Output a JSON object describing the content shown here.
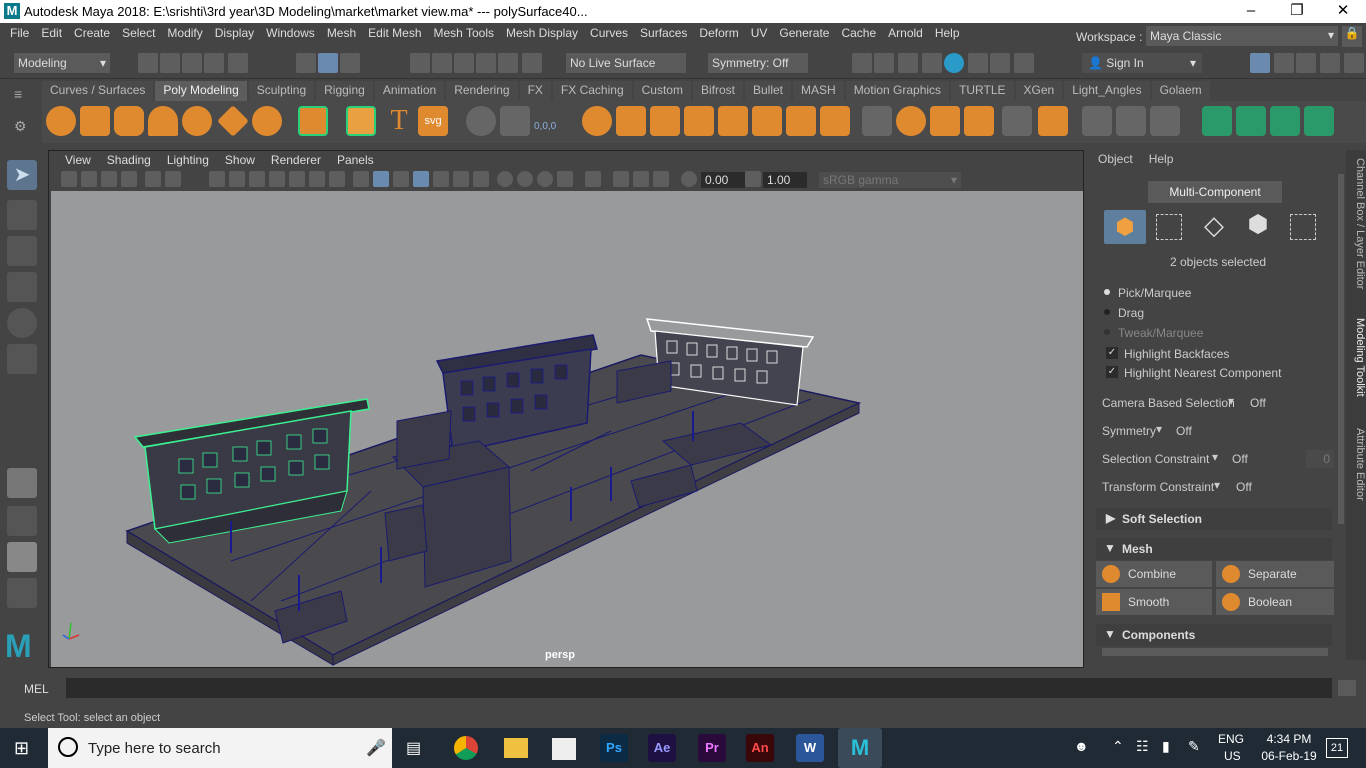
{
  "window": {
    "title": "Autodesk Maya 2018: E:\\srishti\\3rd year\\3D Modeling\\market\\market view.ma*   ---   polySurface40...",
    "logo_letter": "M"
  },
  "menubar": {
    "items": [
      "File",
      "Edit",
      "Create",
      "Select",
      "Modify",
      "Display",
      "Windows",
      "Mesh",
      "Edit Mesh",
      "Mesh Tools",
      "Mesh Display",
      "Curves",
      "Surfaces",
      "Deform",
      "UV",
      "Generate",
      "Cache",
      "Arnold",
      "Help"
    ]
  },
  "workspace": {
    "label": "Workspace :",
    "value": "Maya Classic"
  },
  "statusline": {
    "menu_set": "Modeling",
    "live_surface": "No Live Surface",
    "symmetry": "Symmetry: Off",
    "sign_in": "Sign In"
  },
  "shelf": {
    "tabs": [
      "Curves / Surfaces",
      "Poly Modeling",
      "Sculpting",
      "Rigging",
      "Animation",
      "Rendering",
      "FX",
      "FX Caching",
      "Custom",
      "Bifrost",
      "Bullet",
      "MASH",
      "Motion Graphics",
      "TURTLE",
      "XGen",
      "Light_Angles",
      "Golaem"
    ],
    "active_tab": "Poly Modeling",
    "text_icon_T": "T",
    "text_icon_svg": "svg",
    "coord_label": "0,0,0"
  },
  "viewport": {
    "menus": [
      "View",
      "Shading",
      "Lighting",
      "Show",
      "Renderer",
      "Panels"
    ],
    "exposure": "0.00",
    "gamma": "1.00",
    "color_space": "sRGB gamma",
    "camera_label": "persp"
  },
  "modeling_toolkit": {
    "menus": [
      "Object",
      "Help"
    ],
    "mode_button": "Multi-Component",
    "selection_status": "2 objects selected",
    "pick_options": [
      "Pick/Marquee",
      "Drag",
      "Tweak/Marquee"
    ],
    "checkboxes": [
      "Highlight Backfaces",
      "Highlight Nearest Component"
    ],
    "camera_based_selection": {
      "label": "Camera Based Selection",
      "value": "Off"
    },
    "symmetry": {
      "label": "Symmetry",
      "value": "Off"
    },
    "selection_constraint": {
      "label": "Selection Constraint",
      "value": "Off",
      "extra": "0"
    },
    "transform_constraint": {
      "label": "Transform Constraint",
      "value": "Off"
    },
    "sections": {
      "soft_selection": "Soft Selection",
      "mesh": "Mesh",
      "components": "Components"
    },
    "mesh_buttons": [
      "Combine",
      "Separate",
      "Smooth",
      "Boolean"
    ]
  },
  "side_tabs": [
    "Channel Box / Layer Editor",
    "Modeling Toolkit",
    "Attribute Editor"
  ],
  "cmdline": {
    "label": "MEL"
  },
  "helpline": {
    "text": "Select Tool: select an object"
  },
  "taskbar": {
    "search_placeholder": "Type here to search",
    "apps": [
      "Ps",
      "Ae",
      "Pr",
      "An",
      "W",
      "M"
    ],
    "language": "ENG",
    "region": "US",
    "time": "4:34 PM",
    "date": "06-Feb-19",
    "notifications": "21"
  }
}
